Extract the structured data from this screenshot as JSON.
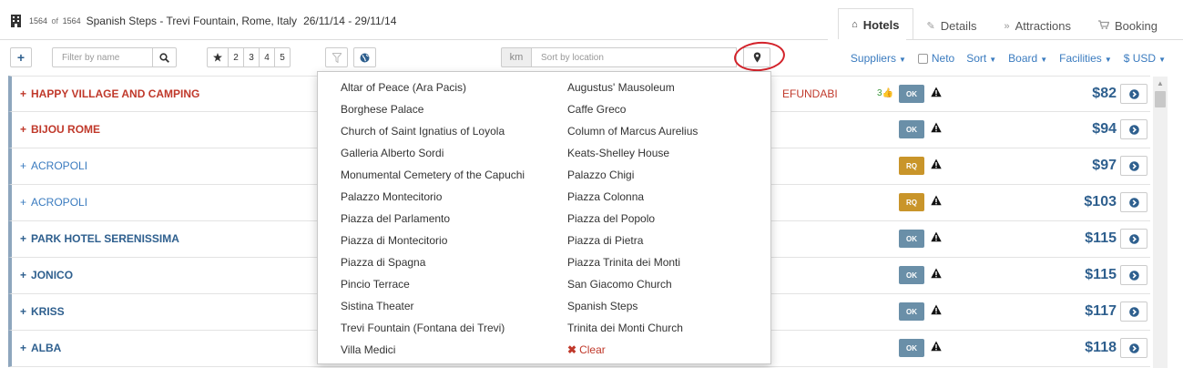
{
  "header": {
    "count_current": "1564",
    "count_of": "of",
    "count_total": "1564",
    "title": "Spanish Steps - Trevi Fountain, Rome, Italy",
    "dates": "26/11/14 - 29/11/14",
    "tabs": [
      {
        "label": "Hotels",
        "icon": "home-icon",
        "active": true
      },
      {
        "label": "Details",
        "icon": "edit-icon",
        "active": false
      },
      {
        "label": "Attractions",
        "icon": "chevrons-icon",
        "active": false
      },
      {
        "label": "Booking",
        "icon": "cart-icon",
        "active": false
      }
    ]
  },
  "toolbar": {
    "add_label": "+",
    "filter_placeholder": "Filter by name",
    "stars": [
      "2",
      "3",
      "4",
      "5"
    ],
    "km_label": "km",
    "sort_placeholder": "Sort by location",
    "menu": {
      "suppliers": "Suppliers",
      "neto": "Neto",
      "sort": "Sort",
      "board": "Board",
      "facilities": "Facilities",
      "currency": "$ USD"
    }
  },
  "hotels": [
    {
      "name": "HAPPY VILLAGE AND CAMPING",
      "style": "red",
      "supplier": "EFUNDABI",
      "likes": "3",
      "status": "OK",
      "price": "$82"
    },
    {
      "name": "BIJOU ROME",
      "style": "red",
      "supplier": "",
      "likes": "",
      "status": "OK",
      "price": "$94"
    },
    {
      "name": "ACROPOLI",
      "style": "light",
      "supplier": "",
      "likes": "",
      "status": "RQ",
      "price": "$97"
    },
    {
      "name": "ACROPOLI",
      "style": "light",
      "supplier": "",
      "likes": "",
      "status": "RQ",
      "price": "$103"
    },
    {
      "name": "PARK HOTEL SERENISSIMA",
      "style": "bold",
      "supplier": "",
      "likes": "",
      "status": "OK",
      "price": "$115"
    },
    {
      "name": "JONICO",
      "style": "bold",
      "supplier": "",
      "likes": "",
      "status": "OK",
      "price": "$115"
    },
    {
      "name": "KRISS",
      "style": "bold",
      "supplier": "",
      "likes": "",
      "status": "OK",
      "price": "$117"
    },
    {
      "name": "ALBA",
      "style": "bold",
      "supplier": "",
      "likes": "",
      "status": "OK",
      "price": "$118"
    }
  ],
  "locations": {
    "col1": [
      "Altar of Peace (Ara Pacis)",
      "Borghese Palace",
      "Church of Saint Ignatius of Loyola",
      "Galleria Alberto Sordi",
      "Monumental Cemetery of the Capuchi",
      "Palazzo Montecitorio",
      "Piazza del Parlamento",
      "Piazza di Montecitorio",
      "Piazza di Spagna",
      "Pincio Terrace",
      "Sistina Theater",
      "Trevi Fountain (Fontana dei Trevi)",
      "Villa Medici"
    ],
    "col2": [
      "Augustus' Mausoleum",
      "Caffe Greco",
      "Column of Marcus Aurelius",
      "Keats-Shelley House",
      "Palazzo Chigi",
      "Piazza Colonna",
      "Piazza del Popolo",
      "Piazza di Pietra",
      "Piazza Trinita dei Monti",
      "San Giacomo Church",
      "Spanish Steps",
      "Trinita dei Monti Church"
    ],
    "clear_label": "Clear"
  },
  "colors": {
    "accent_blue": "#3a7bbf",
    "hotel_red": "#c0392b",
    "ok_badge": "#6a8fa8",
    "rq_badge": "#c9952a",
    "highlight_ring": "#d3222a"
  }
}
